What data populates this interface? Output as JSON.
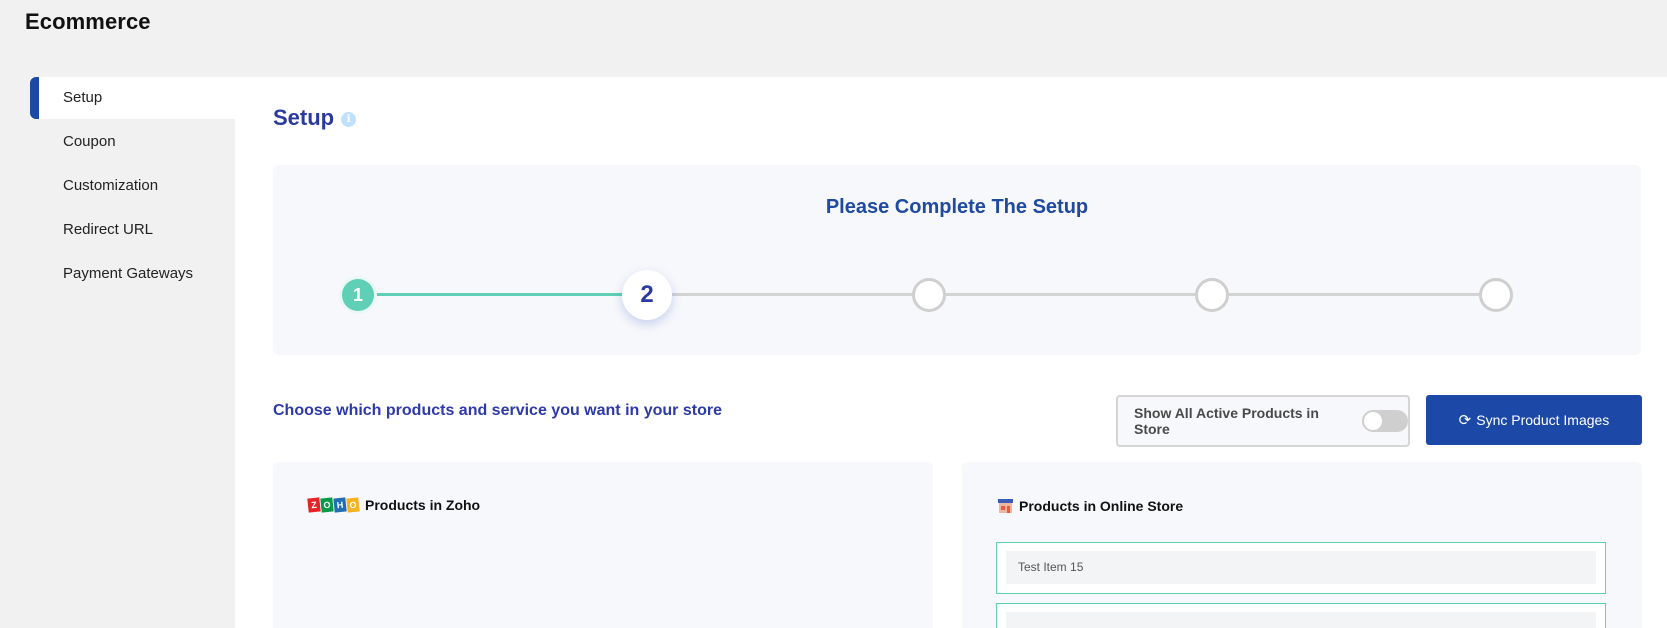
{
  "app": {
    "title": "Ecommerce"
  },
  "sidebar": {
    "items": [
      {
        "label": "Setup",
        "active": true
      },
      {
        "label": "Coupon"
      },
      {
        "label": "Customization"
      },
      {
        "label": "Redirect URL"
      },
      {
        "label": "Payment Gateways"
      }
    ]
  },
  "main": {
    "title": "Setup",
    "info_icon": "info-icon",
    "setup_panel": {
      "heading": "Please Complete The Setup",
      "steps": [
        {
          "number": "1",
          "state": "completed"
        },
        {
          "number": "2",
          "state": "current"
        },
        {
          "number": "",
          "state": "pending"
        },
        {
          "number": "",
          "state": "pending"
        },
        {
          "number": "",
          "state": "pending"
        }
      ]
    },
    "choose_text": "Choose which products and service you want in your store",
    "toggle": {
      "label": "Show All Active Products in Store",
      "on": false
    },
    "sync_button": {
      "label": "Sync Product Images",
      "icon": "refresh-icon"
    },
    "zoho_card": {
      "title": "Products in Zoho",
      "logo_letters": [
        "Z",
        "O",
        "H",
        "O"
      ],
      "logo_colors": [
        "#e42527",
        "#089949",
        "#226db4",
        "#f9b21d"
      ]
    },
    "store_card": {
      "title": "Products in Online Store",
      "items": [
        "Test Item 15",
        ""
      ]
    }
  },
  "colors": {
    "accent": "#1c49a8",
    "step_done": "#5fcfb5",
    "title_blue": "#2a3aa0"
  }
}
